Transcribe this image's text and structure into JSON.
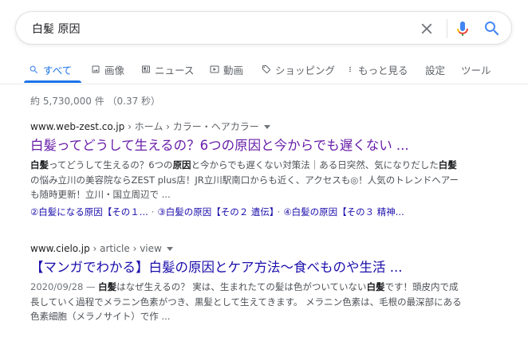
{
  "search": {
    "query": "白髪 原因"
  },
  "tabs": [
    {
      "label": "すべて"
    },
    {
      "label": "画像"
    },
    {
      "label": "ニュース"
    },
    {
      "label": "動画"
    },
    {
      "label": "ショッピング"
    },
    {
      "label": "もっと見る"
    },
    {
      "label": "設定"
    },
    {
      "label": "ツール"
    }
  ],
  "stats": "約 5,730,000 件 （0.37 秒）",
  "results": [
    {
      "domain": "www.web-zest.co.jp",
      "breadcrumb": " › ホーム › カラー・ヘアカラー",
      "title": "白髪ってどうして生えるの？6つの原因と今からでも遅くない ...",
      "snippet": {
        "s1": "白髪",
        "s2": "ってどうして生えるの？6つの",
        "s3": "原因",
        "s4": "と今からでも遅くない対策法｜ある日突然、気になりだした",
        "s5": "白髪",
        "s6": "の悩み立川の美容院ならZEST plus店！JR立川駅南口からも近く、アクセスも◎！人気のトレンドヘアーも随時更新！立川・国立周辺で ..."
      },
      "sitelinks": [
        "②白髪になる原因【その１...",
        "③白髪の原因【その２ 遺伝】",
        "④白髪の原因【その３ 精神..."
      ]
    },
    {
      "domain": "www.cielo.jp",
      "breadcrumb": " › article › view",
      "title": "【マンガでわかる】白髪の原因とケア方法～食べものや生活 ...",
      "snippet": {
        "date": "2020/09/28 — ",
        "s1": "白髪",
        "s2": "はなぜ生えるの？ 実は、生まれたての髪は色がついていない",
        "s3": "白髪",
        "s4": "です！頭皮内で成長していく過程でメラニン色素がつき、黒髪として生えてきます。 メラニン色素は、毛根の最深部にある色素細胞（メラノサイト）で作 ..."
      }
    }
  ],
  "colors": {
    "accent": "#1a73e8",
    "link": "#1a0dab",
    "visited": "#681da8"
  }
}
